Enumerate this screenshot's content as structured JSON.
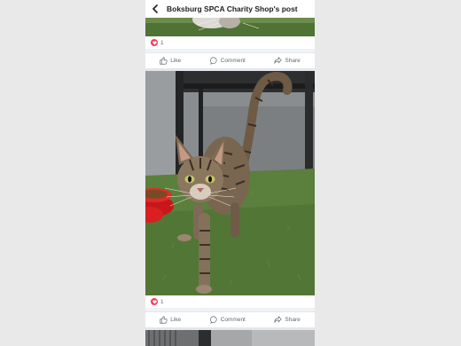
{
  "header": {
    "title": "Boksburg SPCA Charity Shop's post"
  },
  "posts": [
    {
      "reaction_count": "1",
      "like": "Like",
      "comment": "Comment",
      "share": "Share"
    },
    {
      "reaction_count": "1",
      "like": "Like",
      "comment": "Comment",
      "share": "Share"
    }
  ]
}
